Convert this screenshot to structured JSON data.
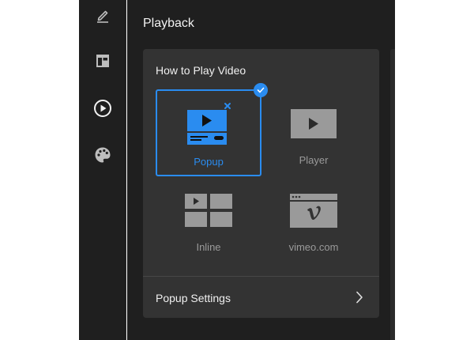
{
  "sidebar": {
    "items": [
      {
        "icon": "pen-icon",
        "active": false
      },
      {
        "icon": "layout-icon",
        "active": false
      },
      {
        "icon": "play-circle-icon",
        "active": true
      },
      {
        "icon": "palette-icon",
        "active": false
      }
    ]
  },
  "main": {
    "title": "Playback",
    "section": {
      "heading": "How to Play Video",
      "options": [
        {
          "label": "Popup",
          "icon": "popup-video-icon",
          "selected": true
        },
        {
          "label": "Player",
          "icon": "player-video-icon",
          "selected": false
        },
        {
          "label": "Inline",
          "icon": "inline-grid-icon",
          "selected": false
        },
        {
          "label": "vimeo.com",
          "icon": "vimeo-window-icon",
          "selected": false
        }
      ]
    },
    "settings_row": {
      "label": "Popup Settings"
    }
  },
  "colors": {
    "accent": "#2a8cf0",
    "background": "#1f1f1f",
    "panel": "#333333",
    "thumb_inactive": "#9a9a9a"
  }
}
